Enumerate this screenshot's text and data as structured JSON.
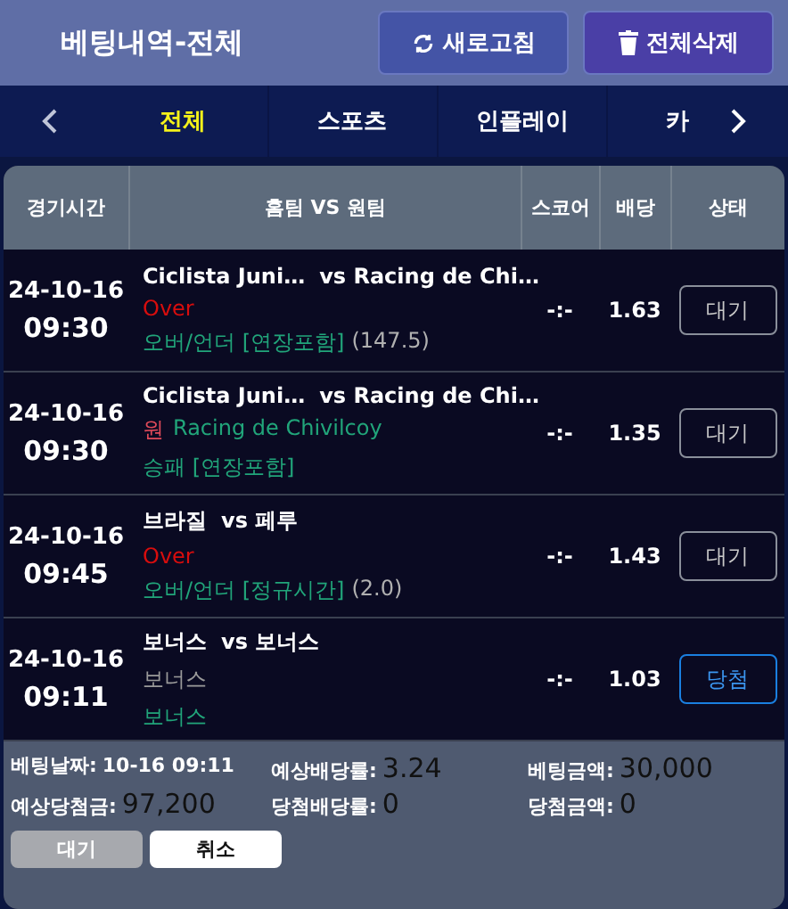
{
  "header": {
    "title": "베팅내역-전체",
    "buttons": [
      {
        "kind": "refresh",
        "label": "새로고침"
      },
      {
        "kind": "delete",
        "label": "전체삭제"
      }
    ]
  },
  "tabs": [
    {
      "label": "전체",
      "selected": true
    },
    {
      "label": "스포츠",
      "selected": false
    },
    {
      "label": "인플레이",
      "selected": false
    },
    {
      "label": "카",
      "selected": false
    }
  ],
  "table": {
    "columns": [
      "경기시간",
      "홈팀 VS 원팀",
      "스코어",
      "배당",
      "상태"
    ],
    "rows": [
      {
        "date": "24-10-16",
        "time": "09:30",
        "home": "Ciclista Juni…",
        "away": "vs Racing de Chi…",
        "pick": [
          {
            "text": "Over",
            "color": "#d80d0d"
          }
        ],
        "market": "오버/언더 [연장포함]",
        "line": "(147.5)",
        "score": "-:-",
        "odds": "1.63",
        "status": {
          "kind": "pending",
          "label": "대기"
        }
      },
      {
        "date": "24-10-16",
        "time": "09:30",
        "home": "Ciclista Juni…",
        "away": "vs Racing de Chi…",
        "pick": [
          {
            "text": "원",
            "color": "#e04a5a"
          },
          {
            "text": "Racing de Chivilcoy",
            "color": "#21a57a"
          }
        ],
        "market": "승패 [연장포함]",
        "score": "-:-",
        "odds": "1.35",
        "status": {
          "kind": "pending",
          "label": "대기"
        }
      },
      {
        "date": "24-10-16",
        "time": "09:45",
        "home": "브라질",
        "away": "vs 페루",
        "pick": [
          {
            "text": "Over",
            "color": "#d80d0d"
          }
        ],
        "market": "오버/언더 [정규시간]",
        "line": "(2.0)",
        "score": "-:-",
        "odds": "1.43",
        "status": {
          "kind": "pending",
          "label": "대기"
        }
      },
      {
        "date": "24-10-16",
        "time": "09:11",
        "home": "보너스",
        "away": "vs 보너스",
        "pick": [
          {
            "text": "보너스",
            "color": "#9a9a9a"
          }
        ],
        "market": "보너스",
        "score": "-:-",
        "odds": "1.03",
        "status": {
          "kind": "won",
          "label": "당첨"
        }
      }
    ]
  },
  "summary": [
    {
      "label": "베팅날짜:",
      "value": "10-16 09:11",
      "kind": "small"
    },
    {
      "label": "예상배당률:",
      "value": "3.24",
      "kind": "large"
    },
    {
      "label": "베팅금액:",
      "value": "30,000",
      "kind": "large"
    },
    {
      "label": "예상당첨금:",
      "value": "97,200",
      "kind": "large"
    },
    {
      "label": "당첨배당률:",
      "value": "0",
      "kind": "large"
    },
    {
      "label": "당첨금액:",
      "value": "0",
      "kind": "large"
    }
  ],
  "actions": [
    {
      "kind": "status",
      "label": "대기"
    },
    {
      "kind": "cancel",
      "label": "취소"
    }
  ]
}
